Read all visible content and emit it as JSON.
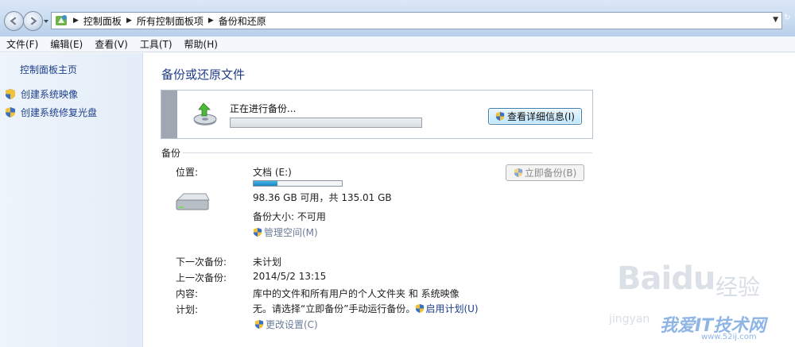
{
  "address": {
    "crumbs": [
      "控制面板",
      "所有控制面板项",
      "备份和还原"
    ]
  },
  "menu": [
    "文件(F)",
    "编辑(E)",
    "查看(V)",
    "工具(T)",
    "帮助(H)"
  ],
  "left": {
    "home": "控制面板主页",
    "tasks": [
      "创建系统映像",
      "创建系统修复光盘"
    ]
  },
  "main": {
    "title": "备份或还原文件",
    "progress": {
      "text": "正在进行备份...",
      "fraction": 0.0,
      "details_button": "查看详细信息(I)"
    },
    "section": "备份",
    "location_label": "位置:",
    "drive_name": "文档 (E:)",
    "drive_used_fraction": 0.27,
    "free_text": "98.36 GB 可用，共 135.01 GB",
    "backup_size": "备份大小: 不可用",
    "manage_space": "管理空间(M)",
    "backup_now": "立即备份(B)",
    "next_label": "下一次备份:",
    "next_value": "未计划",
    "last_label": "上一次备份:",
    "last_value": "2014/5/2 13:15",
    "content_label": "内容:",
    "content_value": "库中的文件和所有用户的个人文件夹 和 系统映像",
    "schedule_label": "计划:",
    "schedule_value": "无。请选择“立即备份”手动运行备份。",
    "enable_schedule": "启用计划(U)",
    "change_settings": "更改设置(C)"
  },
  "watermark": {
    "baidu": "Baidu",
    "jingyan": "经验",
    "jinyan": "jingyan",
    "site": "我爱IT技术网",
    "url": "www.52ij.com"
  },
  "colors": {
    "link": "#1c3e8c",
    "accent_bar": "#1b84c6"
  }
}
